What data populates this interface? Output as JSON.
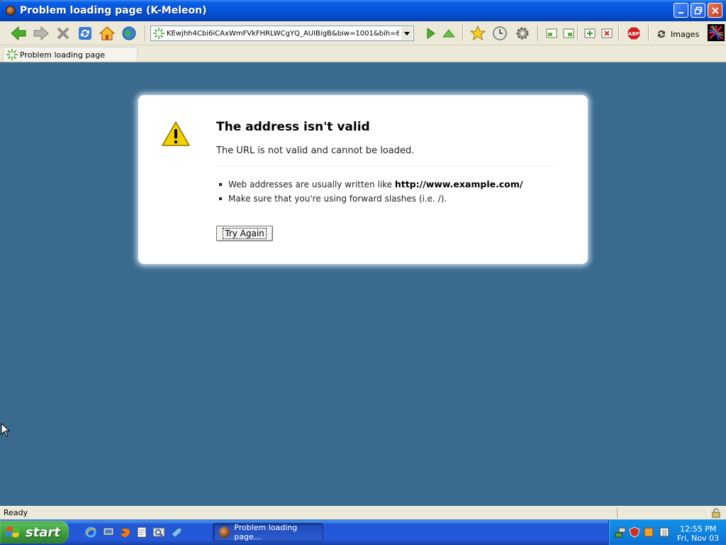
{
  "window": {
    "title": "Problem loading page (K-Meleon)"
  },
  "toolbar": {
    "url": "KEwjhh4Cbi6iCAxWmFVkFHRLWCgYQ_AUIBigB&biw=1001&bih=625",
    "images_label": "Images"
  },
  "tabs": [
    {
      "label": "Problem loading page",
      "active": true
    }
  ],
  "error": {
    "title": "The address isn't valid",
    "description": "The URL is not valid and cannot be loaded.",
    "hint1_prefix": "Web addresses are usually written like ",
    "hint1_example": "http://www.example.com/",
    "hint2": "Make sure that you're using forward slashes (i.e. /).",
    "button_label": "Try Again"
  },
  "status": {
    "text": "Ready"
  },
  "taskbar": {
    "start_label": "start",
    "task_label": "Problem loading page...",
    "clock_time": "12:55 PM",
    "clock_date": "Fri, Nov 03"
  },
  "colors": {
    "page_background": "#3a6a8e",
    "titlebar_blue": "#0553d7",
    "start_green": "#3a9a3a"
  }
}
